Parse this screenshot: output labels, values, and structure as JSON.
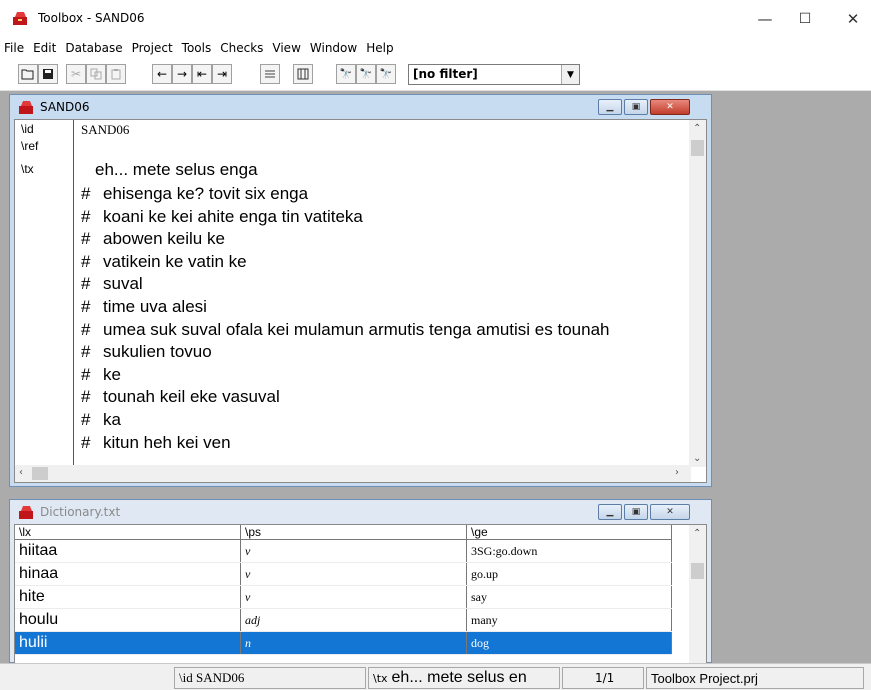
{
  "app": {
    "title": "Toolbox - SAND06"
  },
  "window_controls": {
    "minimize": "—",
    "maximize": "☐",
    "close": "✕"
  },
  "menu": [
    "File",
    "Edit",
    "Database",
    "Project",
    "Tools",
    "Checks",
    "View",
    "Window",
    "Help"
  ],
  "toolbar": {
    "filter_value": "[no filter]"
  },
  "text_window": {
    "title": "SAND06",
    "markers": [
      "\\id",
      "\\ref",
      "\\tx"
    ],
    "id_value": "SAND06",
    "tx_first": "eh... mete selus enga",
    "lines": [
      "ehisenga ke? tovit six enga",
      "koani ke kei ahite enga tin vatiteka",
      "abowen keilu ke",
      "vatikein ke vatin ke",
      "suval",
      "time uva alesi",
      "umea suk suval ofala kei mulamun armutis tenga amutisi es tounah",
      "sukulien tovuo",
      "ke",
      "tounah keil eke vasuval",
      "ka",
      "kitun heh kei ven"
    ],
    "hash": "#"
  },
  "dictionary_window": {
    "title": "Dictionary.txt",
    "headers": [
      "\\lx",
      "\\ps",
      "\\ge"
    ],
    "rows": [
      {
        "lx": "hiitaa",
        "ps": "v",
        "ge": "3SG:go.down"
      },
      {
        "lx": "hinaa",
        "ps": "v",
        "ge": "go.up"
      },
      {
        "lx": "hite",
        "ps": "v",
        "ge": "say"
      },
      {
        "lx": "houlu",
        "ps": "adj",
        "ge": "many"
      },
      {
        "lx": "hulii",
        "ps": "n",
        "ge": "dog"
      }
    ]
  },
  "status_bar": {
    "id": "\\id  SAND06",
    "tx_marker": "\\tx",
    "tx_text": "eh... mete selus en",
    "page": "1/1",
    "project": "Toolbox Project.prj"
  }
}
